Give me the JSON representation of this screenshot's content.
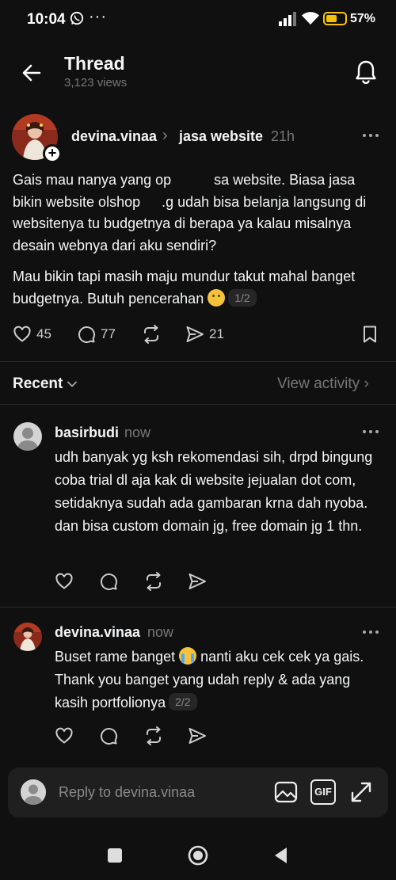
{
  "status_bar": {
    "time": "10:04",
    "notification_dots": "···",
    "battery_percent": "57%",
    "battery_level": 0.57
  },
  "header": {
    "title": "Thread",
    "views": "3,123 views"
  },
  "post": {
    "username": "devina.vinaa",
    "topic": "jasa website",
    "time": "21h",
    "paragraph1": "Gais mau nanya yang ор   sa website. Biasa jasa bikin website olshop  .g udah bisa belanja langsung di websitenya tu budgetnya di berapa ya kalau misalnya desain webnya dari aku sendiri?",
    "paragraph2": "Mau bikin tapi masih maju mundur takut mahal banget budgetnya. Butuh pencerahan",
    "page_indicator": "1/2",
    "likes": "45",
    "comments": "77",
    "shares": "21"
  },
  "recent": {
    "label": "Recent",
    "view_activity": "View activity"
  },
  "replies": [
    {
      "username": "basirbudi",
      "time": "now",
      "text": "udh banyak yg ksh rekomendasi sih, drpd bingung coba trial dl aja kak di website jejualan dot com, setidaknya sudah ada gambaran krna dah nyoba. dan bisa custom domain jg, free domain jg 1 thn."
    },
    {
      "username": "devina.vinaa",
      "time": "now",
      "text_before_emoji": "Buset rame banget",
      "text_after_emoji": "nanti aku cek cek ya gais. Thank you banget yang udah reply & ada yang kasih portfolionya",
      "page_indicator": "2/2"
    }
  ],
  "composer": {
    "placeholder": "Reply to devina.vinaa",
    "gif_label": "GIF"
  },
  "icons": {
    "back": "arrow-left-icon",
    "notifications": "bell-icon",
    "like": "heart-icon",
    "comment": "comment-icon",
    "repost": "repost-icon",
    "share": "send-icon",
    "save": "bookmark-icon",
    "image": "image-icon",
    "gif": "gif-icon",
    "expand": "expand-icon"
  },
  "colors": {
    "background": "#101010",
    "battery": "#f4c20d",
    "muted_text": "#777777"
  }
}
